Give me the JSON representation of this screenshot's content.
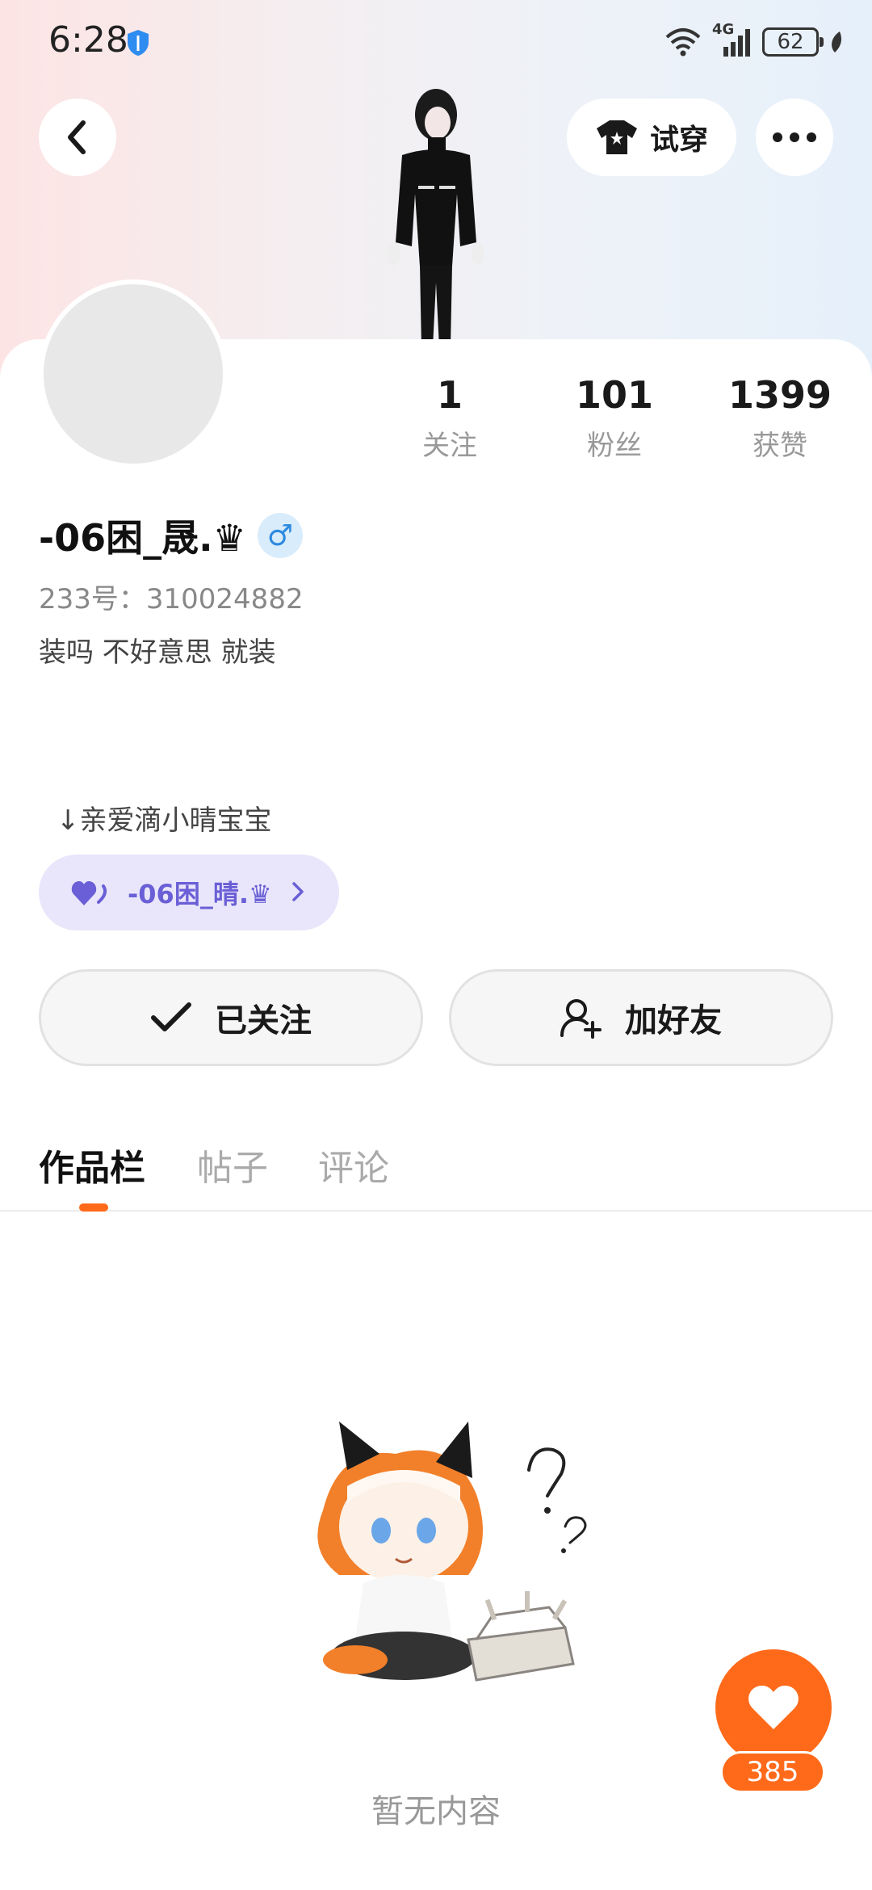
{
  "status_bar": {
    "time": "6:28",
    "network": "4G",
    "battery": "62"
  },
  "header": {
    "try_on_label": "试穿"
  },
  "stats": [
    {
      "value": "1",
      "label": "关注"
    },
    {
      "value": "101",
      "label": "粉丝"
    },
    {
      "value": "1399",
      "label": "获赞"
    }
  ],
  "profile": {
    "name": "-06困_晟.♛",
    "gender_symbol": "♂",
    "uid": "233号：310024882",
    "bio": "装吗 不好意思 就装"
  },
  "couple": {
    "label": "↓亲爱滴小晴宝宝",
    "partner_name": "-06困_晴.♛"
  },
  "actions": {
    "follow_label": "已关注",
    "add_friend_label": "加好友"
  },
  "tabs": [
    "作品栏",
    "帖子",
    "评论"
  ],
  "empty_state": {
    "text": "暂无内容"
  },
  "like_fab": {
    "count": "385"
  },
  "colors": {
    "accent": "#ff6a1a",
    "couple_chip_bg": "#e9e6fb",
    "couple_text": "#6a5fd6",
    "gender_blue": "#2d8ae0"
  }
}
